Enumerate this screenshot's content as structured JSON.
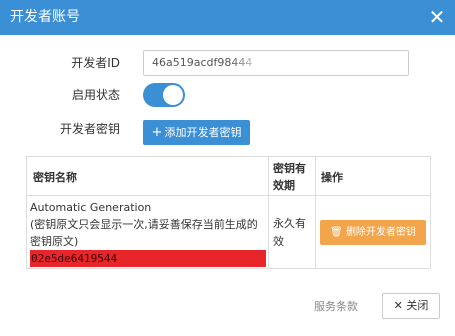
{
  "dialog": {
    "title": "开发者账号",
    "close_glyph": "✕"
  },
  "form": {
    "id_label": "开发者ID",
    "id_value": "46a519acdf98444",
    "status_label": "启用状态",
    "status_enabled": true,
    "key_label": "开发者密钥",
    "add_key_button": "添加开发者密钥",
    "add_key_icon": "+"
  },
  "table": {
    "headers": {
      "name": "密钥名称",
      "expiry": "密钥有效期",
      "actions": "操作"
    },
    "rows": [
      {
        "name_line1": "Automatic Generation",
        "name_line2": "(密钥原文只会显示一次,请妥善保存当前生成的密钥原文)",
        "secret": "02e5de6419544",
        "expiry": "永久有效",
        "delete_button": "删除开发者密钥",
        "delete_icon": "🗑"
      }
    ]
  },
  "footer": {
    "terms_link": "服务条款",
    "close_button": "关闭",
    "close_icon": "✕"
  },
  "colors": {
    "primary": "#3b8fd4",
    "warning": "#f2a54a",
    "secret_highlight": "#e8262a"
  }
}
